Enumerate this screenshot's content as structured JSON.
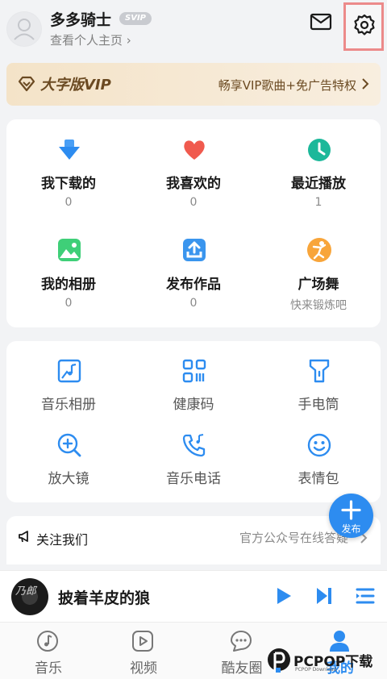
{
  "header": {
    "username": "多多骑士",
    "badge": "SVIP",
    "profile_link": "查看个人主页 ›"
  },
  "vip": {
    "title": "大字版VIP",
    "promo": "畅享VIP歌曲+免广告特权"
  },
  "library": [
    {
      "label": "我下载的",
      "sub": "0",
      "icon": "download-icon"
    },
    {
      "label": "我喜欢的",
      "sub": "0",
      "icon": "heart-icon"
    },
    {
      "label": "最近播放",
      "sub": "1",
      "icon": "clock-icon"
    },
    {
      "label": "我的相册",
      "sub": "0",
      "icon": "photo-icon"
    },
    {
      "label": "发布作品",
      "sub": "0",
      "icon": "upload-icon"
    },
    {
      "label": "广场舞",
      "sub": "快来锻炼吧",
      "icon": "dancer-icon"
    }
  ],
  "tools": [
    {
      "label": "音乐相册",
      "icon": "music-album-icon"
    },
    {
      "label": "健康码",
      "icon": "qr-code-icon"
    },
    {
      "label": "手电筒",
      "icon": "flashlight-icon"
    },
    {
      "label": "放大镜",
      "icon": "magnifier-icon"
    },
    {
      "label": "音乐电话",
      "icon": "music-phone-icon"
    },
    {
      "label": "表情包",
      "icon": "emoji-icon"
    }
  ],
  "follow": {
    "label": "关注我们",
    "desc": "官方公众号在线答疑"
  },
  "fab": {
    "label": "发布"
  },
  "player": {
    "cover_text": "乃郎",
    "song": "披着羊皮的狼"
  },
  "tabs": [
    {
      "label": "音乐",
      "icon": "music-note-icon",
      "active": false
    },
    {
      "label": "视频",
      "icon": "video-icon",
      "active": false
    },
    {
      "label": "酷友圈",
      "icon": "chat-bubble-icon",
      "active": false
    },
    {
      "label": "我的",
      "icon": "person-icon",
      "active": true
    }
  ],
  "watermark": {
    "brand": "PCPOP下载",
    "small": "PCPOP Download"
  },
  "colors": {
    "accent": "#2d8cf0",
    "vip_text": "#6b4a22",
    "highlight_box": "#ec8a8a"
  }
}
